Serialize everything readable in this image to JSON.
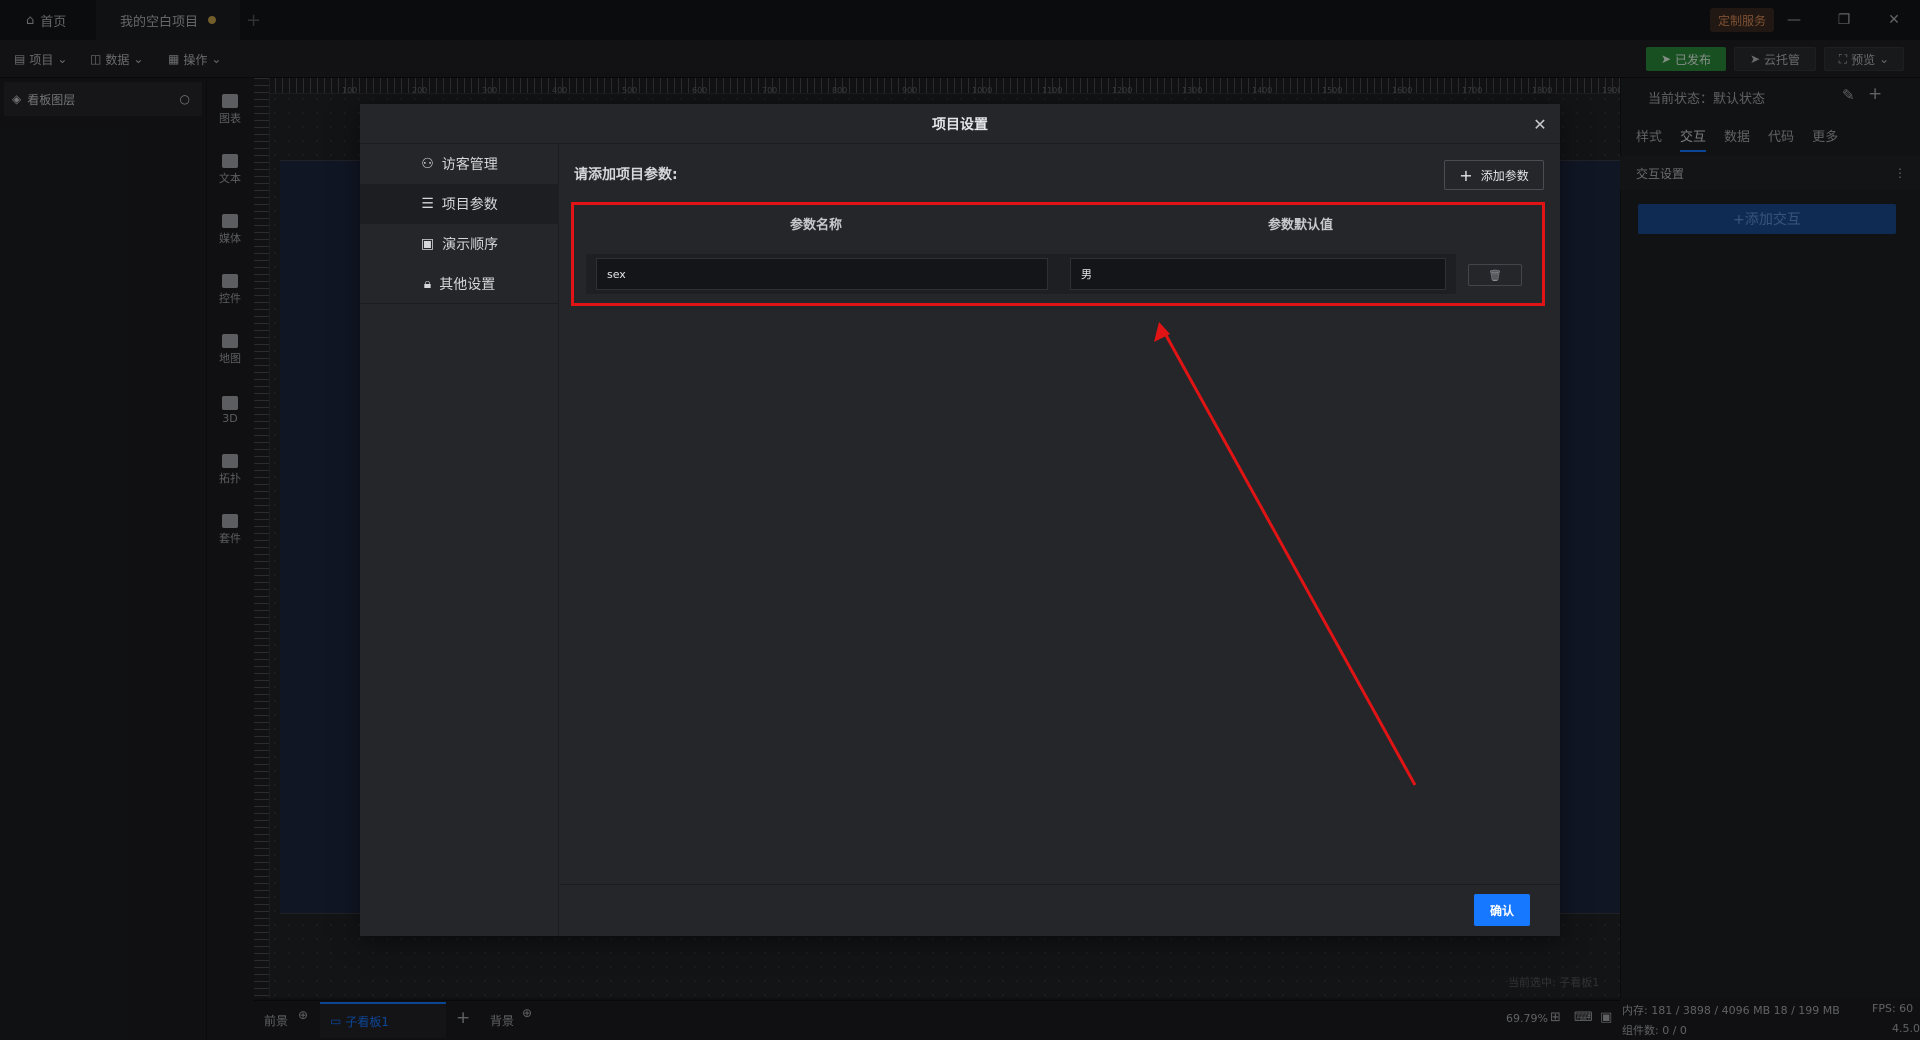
{
  "topbar": {
    "home_tab": "首页",
    "project_tab": "我的空白项目",
    "custom_service": "定制服务"
  },
  "menubar": {
    "project": "项目",
    "data": "数据",
    "operate": "操作",
    "published": "已发布",
    "cloud_host": "云托管",
    "preview": "预览"
  },
  "left_panel": {
    "title": "看板图层"
  },
  "toolbar": {
    "items": [
      "图表",
      "文本",
      "媒体",
      "控件",
      "地图",
      "3D",
      "拓扑",
      "套件"
    ]
  },
  "ruler": {
    "ticks": [
      "100",
      "200",
      "300",
      "400",
      "500",
      "600",
      "700",
      "800",
      "900",
      "1000",
      "1100",
      "1200",
      "1300",
      "1400",
      "1500",
      "1600",
      "1700",
      "1800",
      "1900"
    ]
  },
  "right_panel": {
    "state": "当前状态：默认状态",
    "tabs": [
      "样式",
      "交互",
      "数据",
      "代码",
      "更多"
    ],
    "active_tab": "交互",
    "section": "交互设置",
    "add_interaction": "+添加交互"
  },
  "bottom": {
    "foreground": "前景",
    "sub_board": "子看板1",
    "background": "背景",
    "current_selection": "当前选中: 子看板1",
    "zoom": "69.79%"
  },
  "status": {
    "memory": "内存:  181 / 3898 / 4096 MB  18 / 199 MB",
    "fps": "FPS:  60",
    "components": "组件数: 0 / 0",
    "version": "4.5.0"
  },
  "modal": {
    "title": "项目设置",
    "side_items": [
      "访客管理",
      "项目参数",
      "演示顺序",
      "其他设置"
    ],
    "active_side": "项目参数",
    "content_title": "请添加项目参数:",
    "add_param": "添加参数",
    "col_name": "参数名称",
    "col_default": "参数默认值",
    "param_name_value": "sex",
    "param_default_value": "男",
    "confirm": "确认"
  },
  "colors": {
    "accent": "#1677ff",
    "highlight": "#e01414",
    "publish": "#2b8a3a"
  }
}
